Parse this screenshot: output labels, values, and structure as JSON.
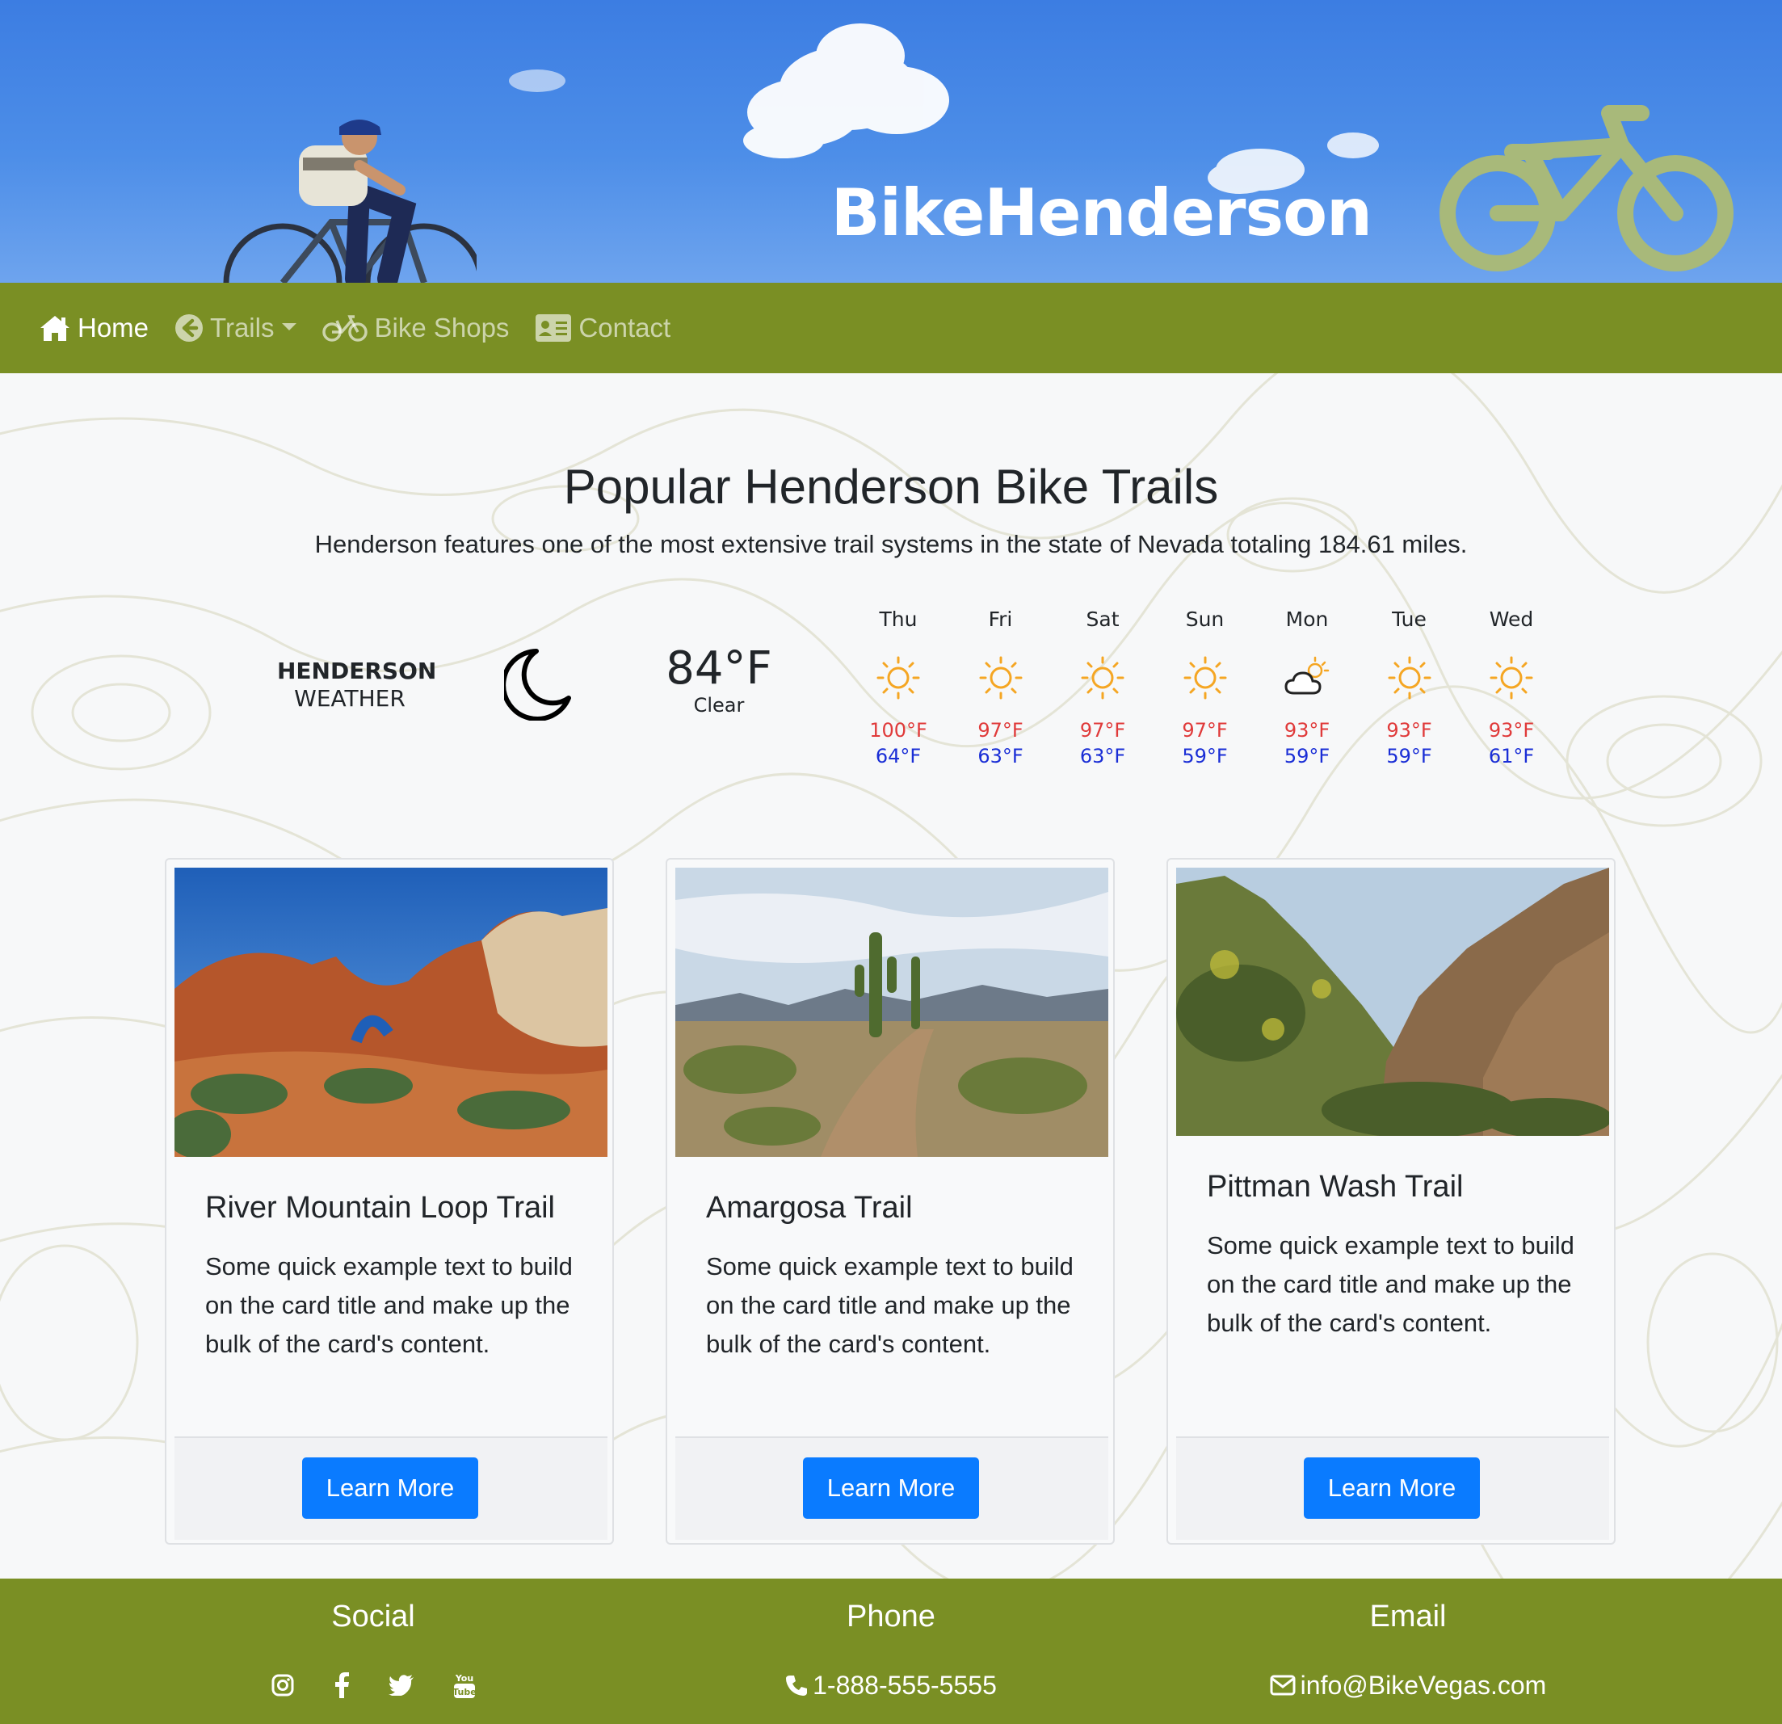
{
  "header": {
    "brand": "BikeHenderson",
    "bike_logo_color": "#a8b97a",
    "sky_color": "#4a8ce8"
  },
  "nav": {
    "background": "#7a8f24",
    "items": [
      {
        "label": "Home",
        "icon": "home-icon",
        "active": true
      },
      {
        "label": "Trails",
        "icon": "arrow-circle-left-icon",
        "dropdown": true
      },
      {
        "label": "Bike Shops",
        "icon": "bicycle-icon"
      },
      {
        "label": "Contact",
        "icon": "address-card-icon"
      }
    ]
  },
  "main": {
    "title": "Popular Henderson Bike Trails",
    "subtitle": "Henderson features one of the most extensive trail systems in the state of Nevada totaling 184.61 miles."
  },
  "weather": {
    "label_line1": "HENDERSON",
    "label_line2": "WEATHER",
    "current_icon": "moon-icon",
    "current_temp": "84°F",
    "current_condition": "Clear",
    "high_color": "#e03a3a",
    "low_color": "#1a2ed6",
    "forecast": [
      {
        "day": "Thu",
        "icon": "sun-icon",
        "high": "100°F",
        "low": "64°F"
      },
      {
        "day": "Fri",
        "icon": "sun-icon",
        "high": "97°F",
        "low": "63°F"
      },
      {
        "day": "Sat",
        "icon": "sun-icon",
        "high": "97°F",
        "low": "63°F"
      },
      {
        "day": "Sun",
        "icon": "sun-icon",
        "high": "97°F",
        "low": "59°F"
      },
      {
        "day": "Mon",
        "icon": "cloud-sun-icon",
        "high": "93°F",
        "low": "59°F"
      },
      {
        "day": "Tue",
        "icon": "sun-icon",
        "high": "93°F",
        "low": "59°F"
      },
      {
        "day": "Wed",
        "icon": "sun-icon",
        "high": "93°F",
        "low": "61°F"
      }
    ]
  },
  "cards": [
    {
      "title": "River Mountain Loop Trail",
      "text": "Some quick example text to build on the card title and make up the bulk of the card's content.",
      "button": "Learn More",
      "image": "red-rock-arch-photo"
    },
    {
      "title": "Amargosa Trail",
      "text": "Some quick example text to build on the card title and make up the bulk of the card's content.",
      "button": "Learn More",
      "image": "desert-path-saguaro-photo"
    },
    {
      "title": "Pittman Wash Trail",
      "text": "Some quick example text to build on the card title and make up the bulk of the card's content.",
      "button": "Learn More",
      "image": "canyon-cactus-photo"
    }
  ],
  "footer": {
    "social_heading": "Social",
    "social_icons": [
      "instagram-icon",
      "facebook-icon",
      "twitter-icon",
      "youtube-icon"
    ],
    "phone_heading": "Phone",
    "phone": "1-888-555-5555",
    "email_heading": "Email",
    "email": "info@BikeVegas.com"
  },
  "button_color": "#0a7bff"
}
